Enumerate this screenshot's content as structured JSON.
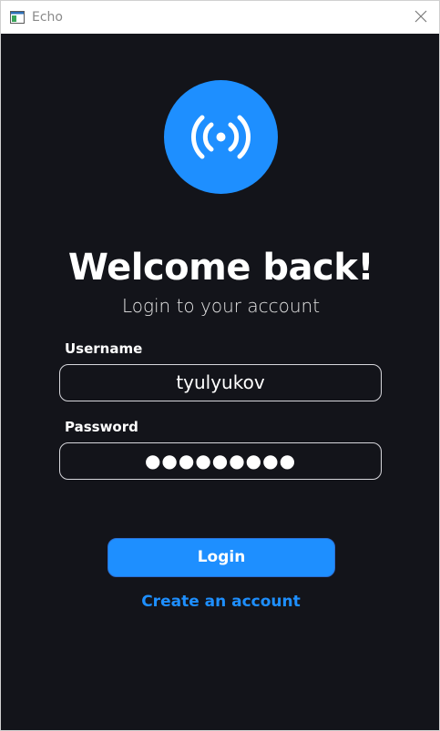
{
  "window": {
    "title": "Echo",
    "icon": "app-window-icon",
    "close_icon": "close-icon"
  },
  "logo": {
    "icon": "broadcast-icon",
    "color": "#1e8fff"
  },
  "login": {
    "heading": "Welcome back!",
    "subheading": "Login to your account",
    "username_label": "Username",
    "username_value": "tyulyukov",
    "password_label": "Password",
    "password_value": "●●●●●●●●●",
    "login_button": "Login",
    "create_account_link": "Create an account"
  },
  "colors": {
    "background": "#13141a",
    "accent": "#1e8fff",
    "text": "#ffffff",
    "input_border": "#d7d7dc"
  }
}
